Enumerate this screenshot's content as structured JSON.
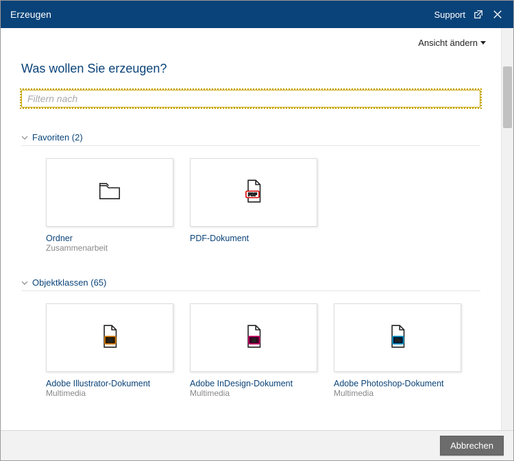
{
  "titlebar": {
    "title": "Erzeugen",
    "support": "Support"
  },
  "viewbar": {
    "change_view": "Ansicht ändern"
  },
  "heading": "Was wollen Sie erzeugen?",
  "filter": {
    "placeholder": "Filtern nach",
    "value": ""
  },
  "sections": {
    "favorites": {
      "label": "Favoriten (2)",
      "items": [
        {
          "title": "Ordner",
          "subtitle": "Zusammenarbeit",
          "icon": "folder"
        },
        {
          "title": "PDF-Dokument",
          "subtitle": "",
          "icon": "pdf"
        }
      ]
    },
    "classes": {
      "label": "Objektklassen (65)",
      "items": [
        {
          "title": "Adobe Illustrator-Dokument",
          "subtitle": "Multimedia",
          "icon": "ai"
        },
        {
          "title": "Adobe InDesign-Dokument",
          "subtitle": "Multimedia",
          "icon": "id"
        },
        {
          "title": "Adobe Photoshop-Dokument",
          "subtitle": "Multimedia",
          "icon": "ps"
        }
      ]
    }
  },
  "footer": {
    "cancel": "Abbrechen"
  }
}
